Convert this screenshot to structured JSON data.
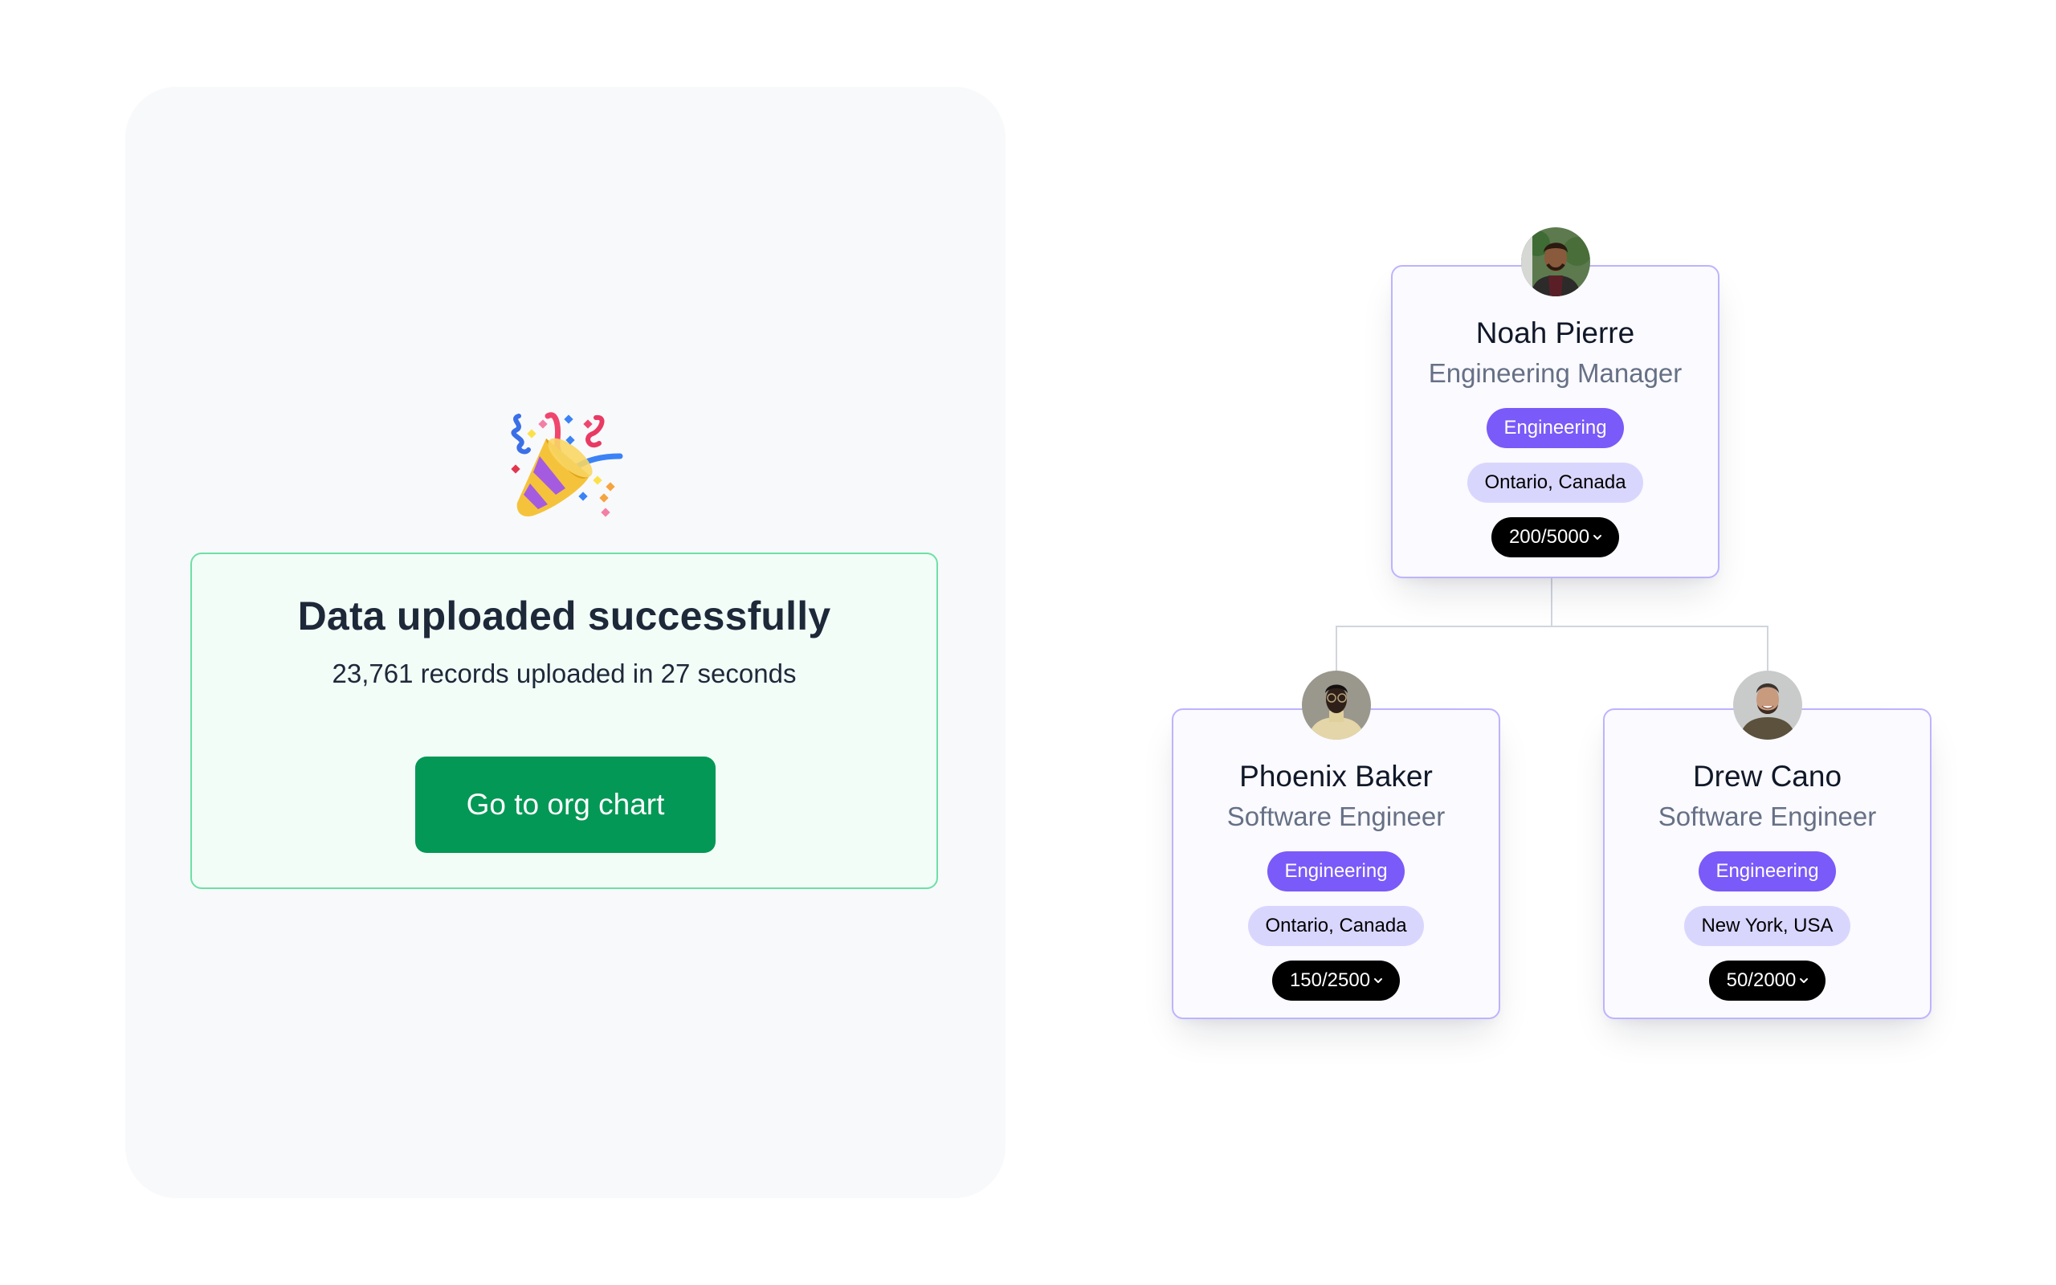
{
  "upload": {
    "icon": "party-popper",
    "title": "Data uploaded successfully",
    "subtitle": "23,761 records uploaded in 27 seconds",
    "cta_label": "Go to org chart"
  },
  "colors": {
    "success_border": "#6CE0A6",
    "success_button": "#039855",
    "card_border": "#BDB4FE",
    "department_chip": "#7A5AF8",
    "location_chip": "#D9D6FE",
    "count_chip": "#000000"
  },
  "org_chart": {
    "manager": {
      "name": "Noah Pierre",
      "role": "Engineering Manager",
      "department": "Engineering",
      "location": "Ontario, Canada",
      "count": "200/5000"
    },
    "reports": [
      {
        "name": "Phoenix Baker",
        "role": "Software Engineer",
        "department": "Engineering",
        "location": "Ontario, Canada",
        "count": "150/2500"
      },
      {
        "name": "Drew Cano",
        "role": "Software Engineer",
        "department": "Engineering",
        "location": "New York, USA",
        "count": "50/2000"
      }
    ]
  }
}
